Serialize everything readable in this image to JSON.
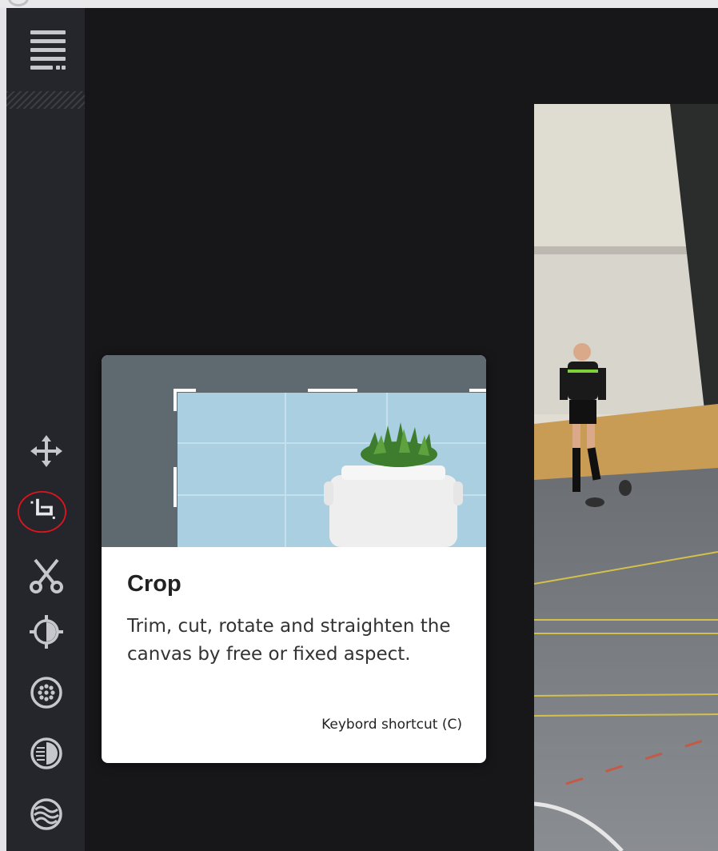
{
  "toolbar": {
    "menu_icon": "hamburger-menu-icon",
    "tools": [
      {
        "id": "move",
        "icon": "move-arrows-icon"
      },
      {
        "id": "crop",
        "icon": "crop-icon",
        "highlighted": true,
        "highlight_color": "#e0141e"
      },
      {
        "id": "cut",
        "icon": "scissors-icon"
      },
      {
        "id": "adjust",
        "icon": "brightness-icon"
      },
      {
        "id": "effects",
        "icon": "dots-circle-icon"
      },
      {
        "id": "gradient",
        "icon": "gradient-circle-icon"
      },
      {
        "id": "texture",
        "icon": "waves-circle-icon"
      }
    ]
  },
  "tooltip": {
    "title": "Crop",
    "description": "Trim, cut, rotate and straighten the canvas by free or fixed aspect.",
    "shortcut": "Keybord shortcut (C)"
  },
  "colors": {
    "sidebar_bg": "#24262b",
    "canvas_bg": "#17171a",
    "icon_color": "#c6c6cc",
    "crop_highlight": "#e0141e"
  }
}
